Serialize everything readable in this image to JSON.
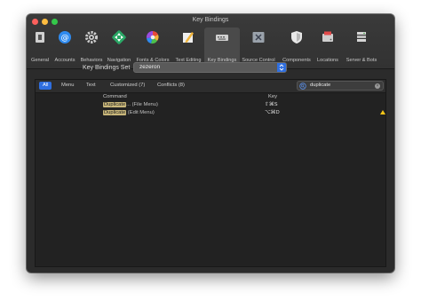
{
  "window": {
    "title": "Key Bindings"
  },
  "toolbar": {
    "items": [
      {
        "label": "General",
        "icon": "general-icon"
      },
      {
        "label": "Accounts",
        "icon": "at-sign-icon"
      },
      {
        "label": "Behaviors",
        "icon": "gear-icon"
      },
      {
        "label": "Navigation",
        "icon": "navigation-arrows-icon"
      },
      {
        "label": "Fonts & Colors",
        "icon": "color-wheel-icon"
      },
      {
        "label": "Text Editing",
        "icon": "pencil-paper-icon"
      },
      {
        "label": "Key Bindings",
        "icon": "keyboard-icon",
        "active": true
      },
      {
        "label": "Source Control",
        "icon": "source-control-icon"
      },
      {
        "label": "Components",
        "icon": "shield-icon"
      },
      {
        "label": "Locations",
        "icon": "drive-icon"
      },
      {
        "label": "Server & Bots",
        "icon": "server-icon"
      }
    ]
  },
  "key_bindings_set": {
    "label": "Key Bindings Set",
    "value": "zezeron"
  },
  "filters": {
    "all": "All",
    "menu": "Menu",
    "text": "Text",
    "customized": "Customized (7)",
    "conflicts": "Conflicts (8)"
  },
  "search": {
    "value": "duplicate"
  },
  "table": {
    "headers": {
      "command": "Command",
      "key": "Key"
    },
    "rows": [
      {
        "match": "Duplicate",
        "rest": "... (File Menu)",
        "key": "⇧⌘S",
        "conflict": false
      },
      {
        "match": "Duplicate",
        "rest": " (Edit Menu)",
        "key": "⌥⌘D",
        "conflict": true
      }
    ]
  },
  "colors": {
    "accent": "#2f6fe0",
    "highlight": "#c9b77a",
    "warning": "#f5c518"
  }
}
